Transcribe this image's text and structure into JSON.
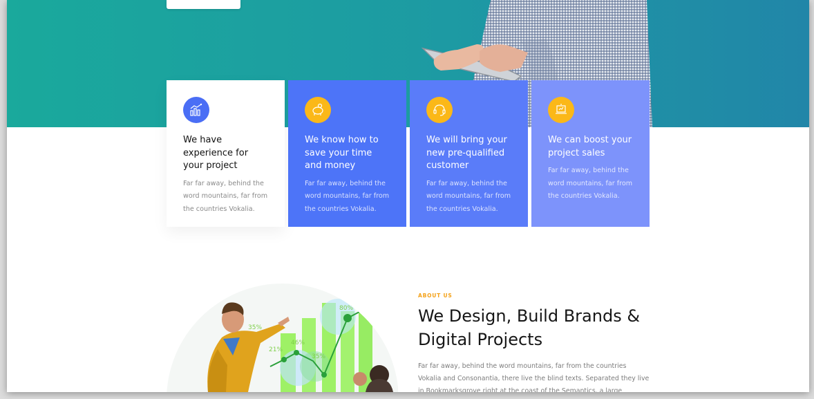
{
  "hero": {
    "button_label": ""
  },
  "features": [
    {
      "icon": "chart-growth-icon",
      "title": "We have experience for your project",
      "text": "Far far away, behind the word mountains, far from the countries Vokalia."
    },
    {
      "icon": "piggy-bank-icon",
      "title": "We know how to save your time and money",
      "text": "Far far away, behind the word mountains, far from the countries Vokalia."
    },
    {
      "icon": "headset-icon",
      "title": "We will bring your new pre-qualified customer",
      "text": "Far far away, behind the word mountains, far from the countries Vokalia."
    },
    {
      "icon": "laptop-growth-icon",
      "title": "We can boost your project sales",
      "text": "Far far away, behind the word mountains, far from the countries Vokalia."
    }
  ],
  "about": {
    "eyebrow": "ABOUT US",
    "title": "We Design, Build Brands & Digital Projects",
    "body": "Far far away, behind the word mountains, far from the countries Vokalia and Consonantia, there live the blind texts. Separated they live in Bookmarksgrove right at the coast of the Semantics, a large",
    "chart_labels": [
      "35%",
      "21%",
      "46%",
      "35%",
      "80%"
    ]
  },
  "colors": {
    "hero_teal": "#1aa99c",
    "card_blue": "#4d74f8",
    "card_blue_light": "#7d93fb",
    "icon_yellow": "#fbb818",
    "icon_blue": "#4a6ef5",
    "accent_orange": "#f4a21a"
  }
}
